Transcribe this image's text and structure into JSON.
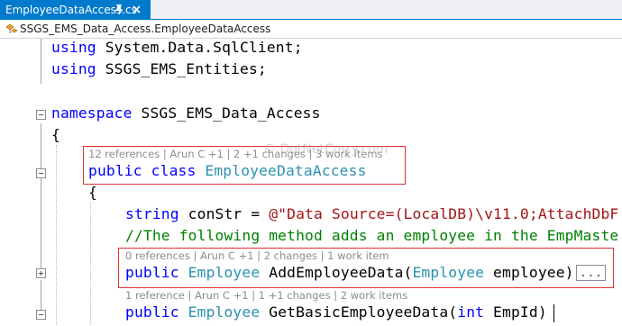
{
  "tab": {
    "filename": "EmployeeDataAccess.cs",
    "pin_icon": "pin-icon",
    "close_label": "x"
  },
  "navbar": {
    "class_path": "SSGS_EMS_Data_Access.EmployeeDataAccess"
  },
  "code": {
    "line1": {
      "keyword": "using",
      "rest": " System.Data.SqlClient;"
    },
    "line2": {
      "keyword": "using",
      "rest": " SSGS_EMS_Entities;"
    },
    "line3": {
      "keyword": "namespace",
      "rest": " SSGS_EMS_Data_Access"
    },
    "line4": "{",
    "lens1": "12 references | Arun C +1 | 2 +1 changes | 3 work items",
    "line5": {
      "kw1": "public",
      "kw2": "class",
      "type": "EmployeeDataAccess"
    },
    "line6": "{",
    "line7": {
      "type": "string",
      "rest": " conStr = ",
      "str": "@\"Data Source=(LocalDB)\\v11.0;AttachDbF"
    },
    "line8": "//The following method adds an employee in the EmpMaste",
    "lens2": "0 references | Arun C +1 | 2 changes | 1 work item",
    "line9": {
      "kw": "public",
      "type1": "Employee",
      "name": " AddEmployeeData(",
      "type2": "Employee",
      "param": " employee)",
      "ellipsis": "..."
    },
    "lens3": "1 reference | Arun C +1 | 1 +1 changes | 2 work items",
    "line10": {
      "kw": "public",
      "type1": "Employee",
      "name": " GetBasicEmployeeData(",
      "kw2": "int",
      "param": " EmpId)"
    }
  },
  "watermark": "© DotNetCurry.com",
  "colors": {
    "tab_active": "#007acc",
    "keyword": "#0000ff",
    "type": "#2b91af",
    "string": "#a31515",
    "comment": "#008000",
    "highlight_box": "#e03030"
  }
}
